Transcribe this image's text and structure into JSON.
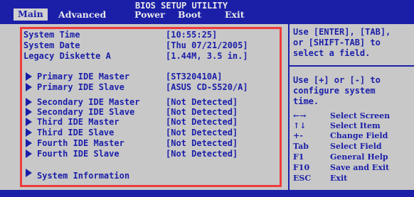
{
  "header": {
    "title": "BIOS SETUP UTILITY",
    "tabs": [
      {
        "label": "Main",
        "active": true
      },
      {
        "label": "Advanced",
        "active": false
      },
      {
        "label": "Power",
        "active": false
      },
      {
        "label": "Boot",
        "active": false
      },
      {
        "label": "Exit",
        "active": false
      }
    ]
  },
  "settings": [
    {
      "label": "System Time",
      "value": "[10:55:25]"
    },
    {
      "label": "System Date",
      "value": "[Thu 07/21/2005]"
    },
    {
      "label": "Legacy Diskette A",
      "value": "[1.44M, 3.5 in.]"
    }
  ],
  "submenus": [
    {
      "label": "Primary IDE Master",
      "value": "[ST320410A]"
    },
    {
      "label": "Primary IDE Slave",
      "value": "[ASUS CD-S520/A]"
    },
    {
      "label": "Secondary IDE Master",
      "value": "[Not Detected]"
    },
    {
      "label": "Secondary IDE Slave",
      "value": "[Not Detected]"
    },
    {
      "label": "Third IDE Master",
      "value": "[Not Detected]"
    },
    {
      "label": "Third IDE Slave",
      "value": "[Not Detected]"
    },
    {
      "label": "Fourth IDE Master",
      "value": "[Not Detected]"
    },
    {
      "label": "Fourth IDE Slave",
      "value": "[Not Detected]"
    }
  ],
  "system_info": {
    "label": "System Information"
  },
  "help": {
    "line1": "Use [ENTER], [TAB],",
    "line2": "or [SHIFT-TAB] to",
    "line3": "select a field.",
    "line4": "Use  [+] or [-] to",
    "line5": "configure system",
    "line6": "time."
  },
  "keys": [
    {
      "key": "←→",
      "desc": "Select Screen"
    },
    {
      "key": "↑↓",
      "desc": "Select Item"
    },
    {
      "key": "+-",
      "desc": "Change Field"
    },
    {
      "key": "Tab",
      "desc": "Select Field"
    },
    {
      "key": "F1",
      "desc": "General Help"
    },
    {
      "key": "F10",
      "desc": "Save and Exit"
    },
    {
      "key": "ESC",
      "desc": "Exit"
    }
  ],
  "colors": {
    "bar": "#1b1fa8",
    "panel": "#c8c8c8",
    "text": "#1b1fa8",
    "highlight_border": "#ef3b3b"
  }
}
